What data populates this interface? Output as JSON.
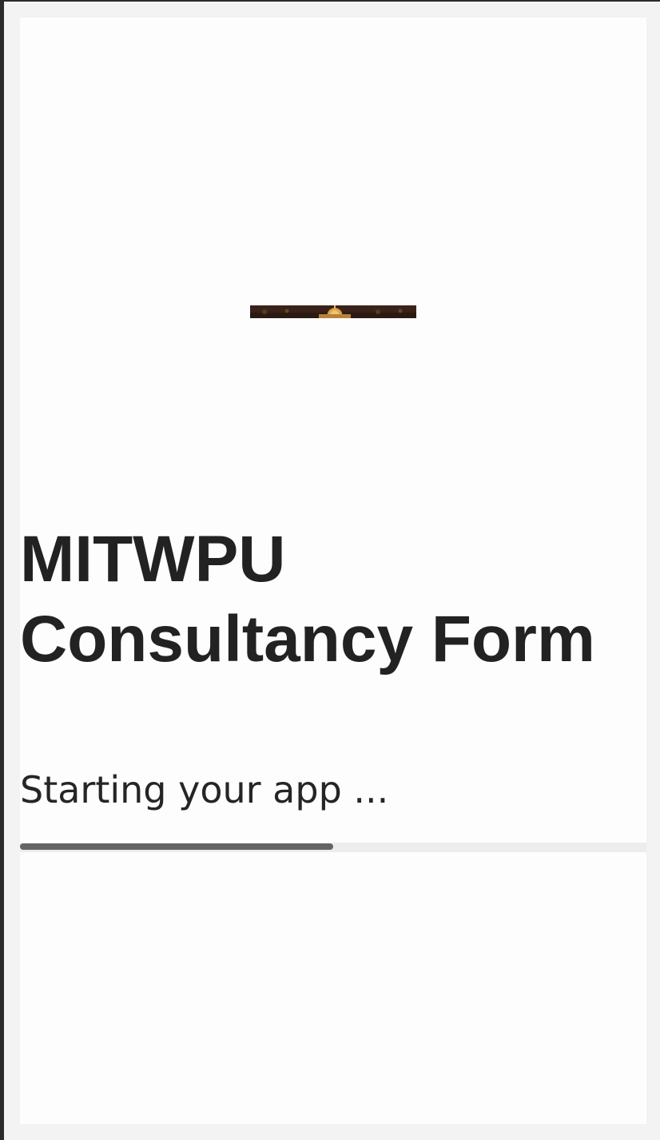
{
  "app": {
    "title_line1": "MITWPU",
    "title_line2": "Consultancy Form"
  },
  "status": {
    "loading_text": "Starting your app ..."
  },
  "progress": {
    "fraction": 0.5
  },
  "colors": {
    "title": "#222222",
    "progress_fill": "#646464",
    "progress_track": "#ededed"
  }
}
